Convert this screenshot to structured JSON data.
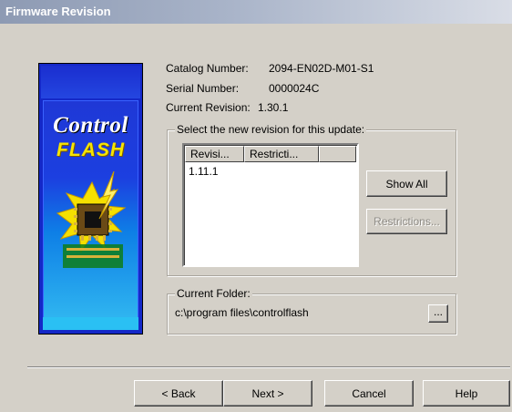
{
  "window": {
    "title": "Firmware Revision"
  },
  "logo": {
    "word1": "Control",
    "word2": "FLASH"
  },
  "info": {
    "catalog_label": "Catalog Number:",
    "catalog_value": "2094-EN02D-M01-S1",
    "serial_label": "Serial Number:",
    "serial_value": "0000024C",
    "revision_label": "Current Revision:",
    "revision_value": "1.30.1"
  },
  "revision_group": {
    "legend": "Select the new revision for this update:",
    "columns": [
      "Revisi...",
      "Restricti..."
    ],
    "rows": [
      "1.11.1"
    ],
    "show_all_label": "Show All",
    "restrictions_label": "Restrictions..."
  },
  "folder_group": {
    "legend": "Current Folder:",
    "path": "c:\\program files\\controlflash",
    "browse_label": "..."
  },
  "footer": {
    "back_label": "< Back",
    "next_label": "Next >",
    "cancel_label": "Cancel",
    "help_label": "Help"
  }
}
